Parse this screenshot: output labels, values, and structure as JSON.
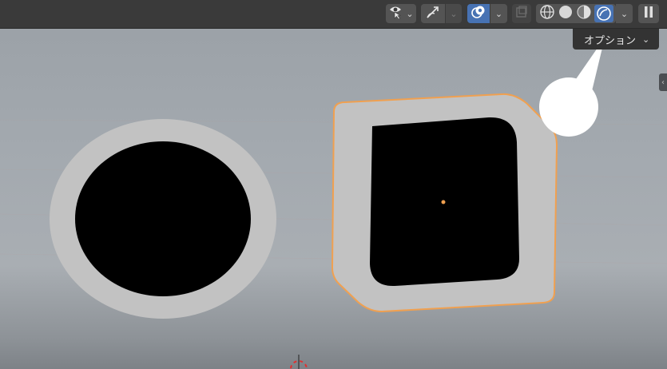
{
  "header": {
    "visibility_icon": "eye-arrow-icon",
    "gizmo_icon": "transform-gizmo-icon",
    "overlay_icon": "overlay-circles-icon",
    "xray_icon": "xray-square-icon",
    "shading_modes": [
      "wireframe-shading-icon",
      "solid-shading-icon",
      "material-preview-shading-icon",
      "rendered-shading-icon"
    ],
    "active_shading": "rendered-shading-icon",
    "pause_icon": "pause-icon"
  },
  "options": {
    "label": "オプション"
  },
  "colors": {
    "header_bg": "#3a3a3a",
    "active_blue": "#4772b3",
    "selection_orange": "#f0a050",
    "object_light": "#c2c2c2",
    "object_dark": "#000000"
  }
}
